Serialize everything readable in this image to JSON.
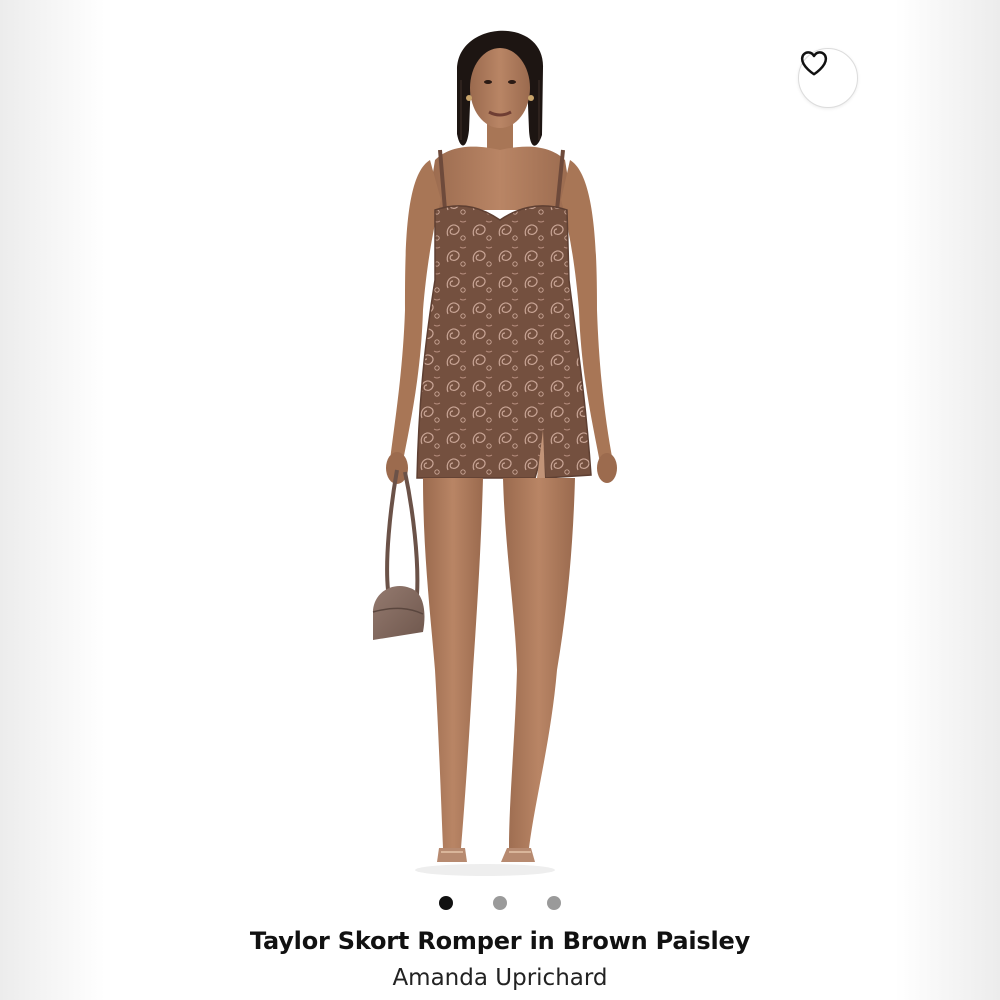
{
  "product": {
    "title": "Taylor Skort Romper in Brown Paisley",
    "brand": "Amanda Uprichard",
    "image_alt": "Model wearing a brown paisley print mini romper with a side slit, holding a taupe shoulder bag"
  },
  "gallery": {
    "total_images": 3,
    "active_index": 0
  },
  "favorite": {
    "icon": "heart-outline-icon"
  },
  "colors": {
    "accent_text": "#111111",
    "dot_active": "#111111",
    "dot_inactive": "#9a9a9a",
    "romper": "#7a5546",
    "skin": "#b07c5c",
    "bag": "#8a7065"
  }
}
